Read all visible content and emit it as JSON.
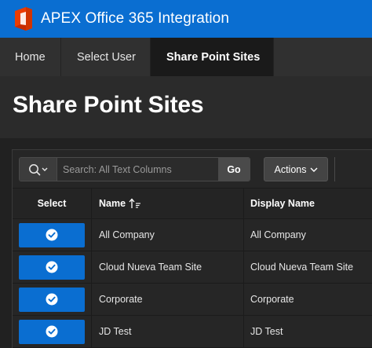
{
  "header": {
    "title": "APEX Office 365 Integration",
    "logo_icon": "office-logo-icon"
  },
  "nav": {
    "tabs": [
      {
        "label": "Home",
        "active": false
      },
      {
        "label": "Select User",
        "active": false
      },
      {
        "label": "Share Point Sites",
        "active": true
      }
    ]
  },
  "page": {
    "title": "Share Point Sites"
  },
  "toolbar": {
    "search_placeholder": "Search: All Text Columns",
    "go_label": "Go",
    "actions_label": "Actions"
  },
  "grid": {
    "columns": {
      "select": "Select",
      "name": "Name",
      "display": "Display Name"
    },
    "sort": {
      "column": "name",
      "direction": "ascending"
    },
    "rows": [
      {
        "name": "All Company",
        "display": "All Company"
      },
      {
        "name": "Cloud Nueva Team Site",
        "display": "Cloud Nueva Team Site"
      },
      {
        "name": "Corporate",
        "display": "Corporate"
      },
      {
        "name": "JD Test",
        "display": "JD Test"
      }
    ]
  },
  "colors": {
    "header": "#0a6ed1",
    "select_button": "#0a6ed1",
    "background": "#212121"
  }
}
